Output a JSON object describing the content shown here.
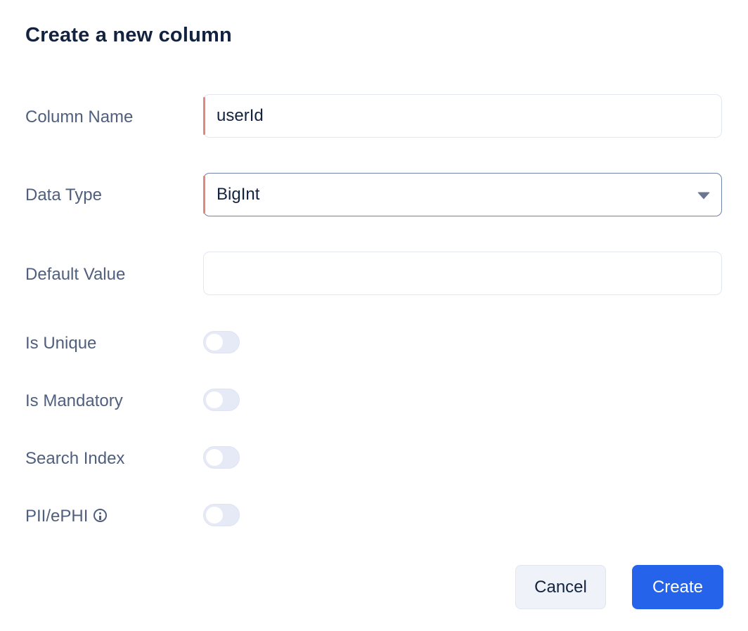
{
  "dialog": {
    "title": "Create a new column"
  },
  "form": {
    "column_name": {
      "label": "Column Name",
      "value": "userId"
    },
    "data_type": {
      "label": "Data Type",
      "value": "BigInt"
    },
    "default_value": {
      "label": "Default Value",
      "value": ""
    },
    "toggles": [
      {
        "label": "Is Unique",
        "checked": false
      },
      {
        "label": "Is Mandatory",
        "checked": false
      },
      {
        "label": "Search Index",
        "checked": false
      },
      {
        "label": "PII/ePHI",
        "checked": false,
        "icon": "info-icon"
      }
    ]
  },
  "actions": {
    "cancel_label": "Cancel",
    "create_label": "Create"
  },
  "colors": {
    "primary": "#2563eb",
    "error_indicator": "#e2877f",
    "label": "#4f5f7d",
    "text": "#13233f"
  }
}
